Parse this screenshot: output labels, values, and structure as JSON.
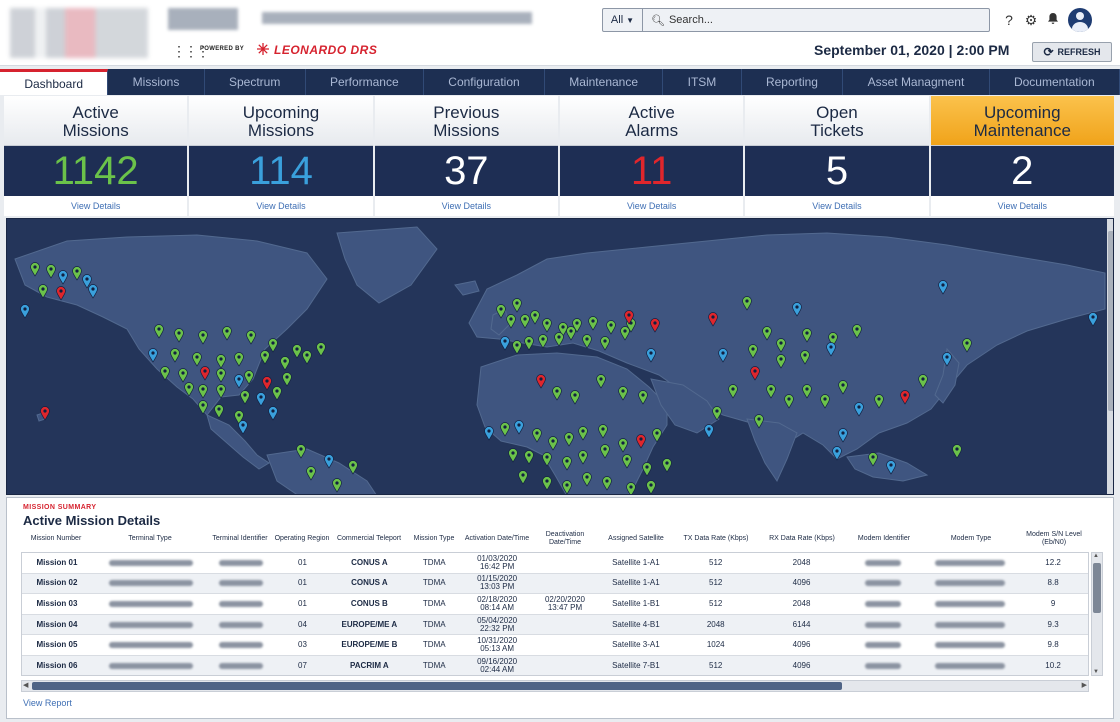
{
  "header": {
    "search": {
      "scope": "All",
      "placeholder": "Search..."
    },
    "icons": [
      "help-icon",
      "gear-icon",
      "bell-icon",
      "user-avatar-icon"
    ],
    "powered_by": "POWERED BY",
    "brand": "LEONARDO DRS",
    "datetime": "September 01, 2020 | 2:00 PM",
    "refresh_label": "REFRESH"
  },
  "nav": {
    "tabs": [
      "Dashboard",
      "Missions",
      "Spectrum",
      "Performance",
      "Configuration",
      "Maintenance",
      "ITSM",
      "Reporting",
      "Asset Managment",
      "Documentation"
    ],
    "active": "Dashboard"
  },
  "stats": [
    {
      "title": "Active\nMissions",
      "value": "1142",
      "color": "#6bc24a",
      "link": "View Details"
    },
    {
      "title": "Upcoming\nMissions",
      "value": "114",
      "color": "#3aa0dc",
      "link": "View Details"
    },
    {
      "title": "Previous\nMissions",
      "value": "37",
      "color": "#ffffff",
      "link": "View Details"
    },
    {
      "title": "Active\nAlarms",
      "value": "11",
      "color": "#e0262c",
      "link": "View Details"
    },
    {
      "title": "Open\nTickets",
      "value": "5",
      "color": "#ffffff",
      "link": "View Details"
    },
    {
      "title": "Upcoming\nMaintenance",
      "value": "2",
      "color": "#ffffff",
      "link": "View Details"
    }
  ],
  "summary": {
    "kicker": "MISSION SUMMARY",
    "title": "Active Mission Details",
    "columns": [
      "Mission Number",
      "Terminal Type",
      "Terminal Identifier",
      "Operating Region",
      "Commercial Teleport",
      "Mission Type",
      "Activation Date/Time",
      "Deactivation Date/Time",
      "Assigned Satellite",
      "TX Data Rate (Kbps)",
      "RX Data Rate (Kbps)",
      "Modem Identifier",
      "Modem Type",
      "Modem S/N Level (Eb/N0)"
    ],
    "rows": [
      [
        "Mission 01",
        "",
        "",
        "01",
        "CONUS A",
        "TDMA",
        "01/03/2020\n16:42 PM",
        "",
        "Satellite 1-A1",
        "512",
        "2048",
        "",
        "",
        "12.2"
      ],
      [
        "Mission 02",
        "",
        "",
        "01",
        "CONUS A",
        "TDMA",
        "01/15/2020\n13:03 PM",
        "",
        "Satellite 1-A1",
        "512",
        "4096",
        "",
        "",
        "8.8"
      ],
      [
        "Mission 03",
        "",
        "",
        "01",
        "CONUS B",
        "TDMA",
        "02/18/2020\n08:14 AM",
        "02/20/2020\n13:47 PM",
        "Satellite 1-B1",
        "512",
        "2048",
        "",
        "",
        "9"
      ],
      [
        "Mission 04",
        "",
        "",
        "04",
        "EUROPE/ME A",
        "TDMA",
        "05/04/2020\n22:32 PM",
        "",
        "Satellite 4-B1",
        "2048",
        "6144",
        "",
        "",
        "9.3"
      ],
      [
        "Mission 05",
        "",
        "",
        "03",
        "EUROPE/ME B",
        "TDMA",
        "10/31/2020\n05:13 AM",
        "",
        "Satellite 3-A1",
        "1024",
        "4096",
        "",
        "",
        "9.8"
      ],
      [
        "Mission 06",
        "",
        "",
        "07",
        "PACRIM A",
        "TDMA",
        "09/16/2020\n02:44 AM",
        "",
        "Satellite 7-B1",
        "512",
        "4096",
        "",
        "",
        "10.2"
      ]
    ],
    "view_report": "View Report"
  },
  "map": {
    "pin_colors": {
      "active": "#6bc24a",
      "upcoming": "#3aa0dc",
      "alarm": "#e0262c"
    }
  }
}
